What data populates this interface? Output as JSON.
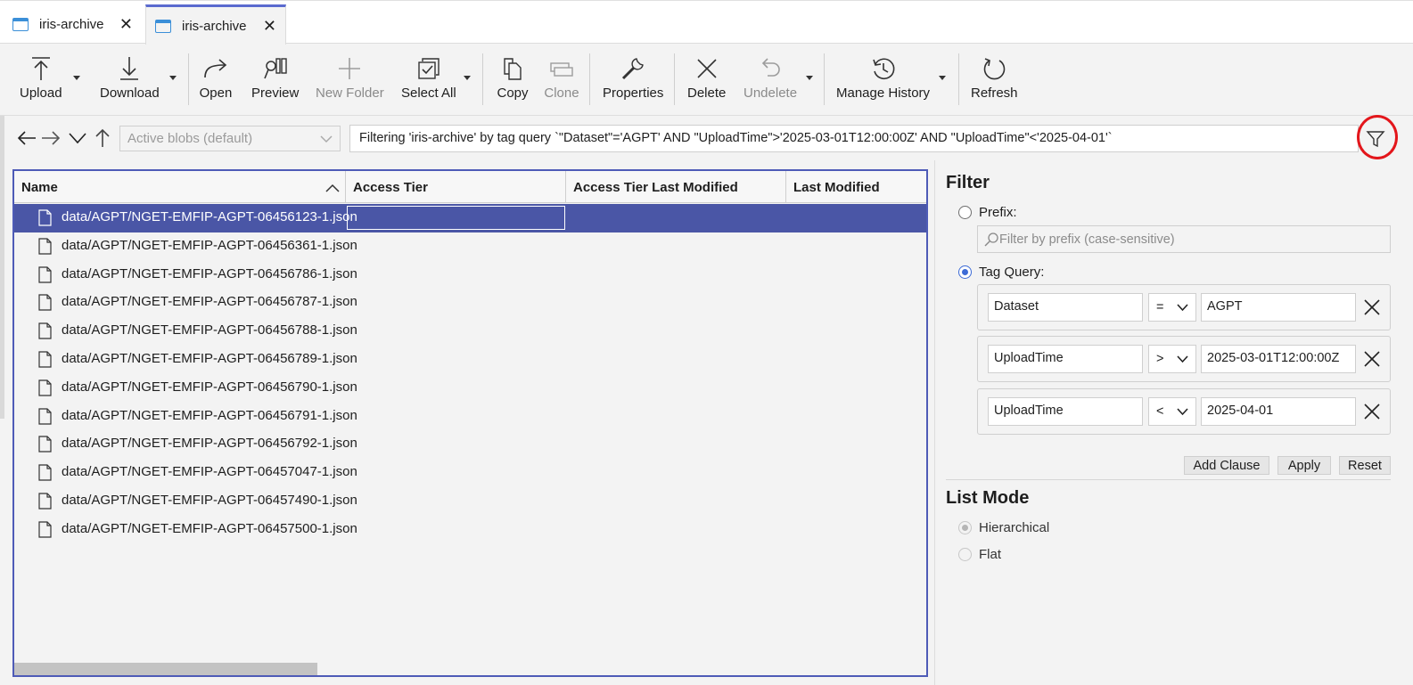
{
  "tabs": [
    {
      "label": "iris-archive"
    },
    {
      "label": "iris-archive"
    }
  ],
  "toolbar": {
    "upload": "Upload",
    "download": "Download",
    "open": "Open",
    "preview": "Preview",
    "new_folder": "New Folder",
    "select_all": "Select All",
    "copy": "Copy",
    "clone": "Clone",
    "properties": "Properties",
    "delete": "Delete",
    "undelete": "Undelete",
    "manage_history": "Manage History",
    "refresh": "Refresh"
  },
  "address": {
    "view_select": "Active blobs (default)",
    "query_text": "Filtering 'iris-archive' by tag query `\"Dataset\"='AGPT' AND \"UploadTime\">'2025-03-01T12:00:00Z' AND \"UploadTime\"<'2025-04-01'`"
  },
  "table": {
    "columns": [
      "Name",
      "Access Tier",
      "Access Tier Last Modified",
      "Last Modified"
    ],
    "rows": [
      "data/AGPT/NGET-EMFIP-AGPT-06456123-1.json",
      "data/AGPT/NGET-EMFIP-AGPT-06456361-1.json",
      "data/AGPT/NGET-EMFIP-AGPT-06456786-1.json",
      "data/AGPT/NGET-EMFIP-AGPT-06456787-1.json",
      "data/AGPT/NGET-EMFIP-AGPT-06456788-1.json",
      "data/AGPT/NGET-EMFIP-AGPT-06456789-1.json",
      "data/AGPT/NGET-EMFIP-AGPT-06456790-1.json",
      "data/AGPT/NGET-EMFIP-AGPT-06456791-1.json",
      "data/AGPT/NGET-EMFIP-AGPT-06456792-1.json",
      "data/AGPT/NGET-EMFIP-AGPT-06457047-1.json",
      "data/AGPT/NGET-EMFIP-AGPT-06457490-1.json",
      "data/AGPT/NGET-EMFIP-AGPT-06457500-1.json"
    ]
  },
  "filter": {
    "title": "Filter",
    "prefix_label": "Prefix:",
    "prefix_placeholder": "Filter by prefix (case-sensitive)",
    "tag_query_label": "Tag Query:",
    "clauses": [
      {
        "key": "Dataset",
        "op": "=",
        "value": "AGPT"
      },
      {
        "key": "UploadTime",
        "op": ">",
        "value": "2025-03-01T12:00:00Z"
      },
      {
        "key": "UploadTime",
        "op": "<",
        "value": "2025-04-01"
      }
    ],
    "add_clause": "Add Clause",
    "apply": "Apply",
    "reset": "Reset"
  },
  "list_mode": {
    "title": "List Mode",
    "hierarchical": "Hierarchical",
    "flat": "Flat"
  },
  "colors": {
    "accent": "#4a56a6",
    "highlight_circle": "#e3161b"
  }
}
